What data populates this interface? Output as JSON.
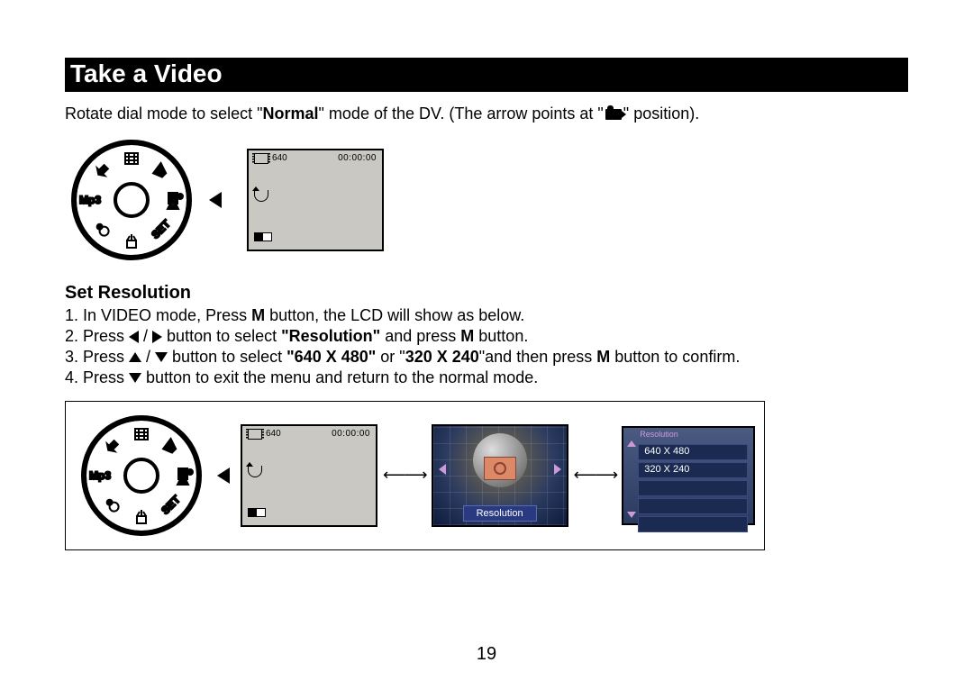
{
  "title": "Take a Video",
  "intro": {
    "pre": "Rotate dial mode to select \"",
    "bold1": "Normal",
    "mid": "\" mode of the DV. (The arrow points at \"",
    "post": "\" position)."
  },
  "lcd": {
    "res": "640",
    "time": "00:00:00"
  },
  "subhead": "Set Resolution",
  "steps": {
    "s1a": "1. In VIDEO mode, Press ",
    "s1b": "M",
    "s1c": " button, the LCD will show as below.",
    "s2a": "2. Press ",
    "s2b": " button to select ",
    "s2c": "\"Resolution\"",
    "s2d": " and press ",
    "s2e": "M",
    "s2f": " button.",
    "s3a": "3. Press ",
    "s3b": " button to select ",
    "s3c": "\"640 X 480\"",
    "s3d": " or \"",
    "s3e": "320 X 240",
    "s3f": "\"and then press ",
    "s3g": "M",
    "s3h": " button to confirm.",
    "s4a": "4. Press ",
    "s4b": "button to exit the menu and return to the normal mode."
  },
  "menu": {
    "label": "Resolution",
    "header": "Resolution",
    "items": [
      "640 X 480",
      "320 X 240",
      "",
      "",
      ""
    ]
  },
  "arrows": {
    "dbl": "⟵⟶"
  },
  "page_number": "19"
}
